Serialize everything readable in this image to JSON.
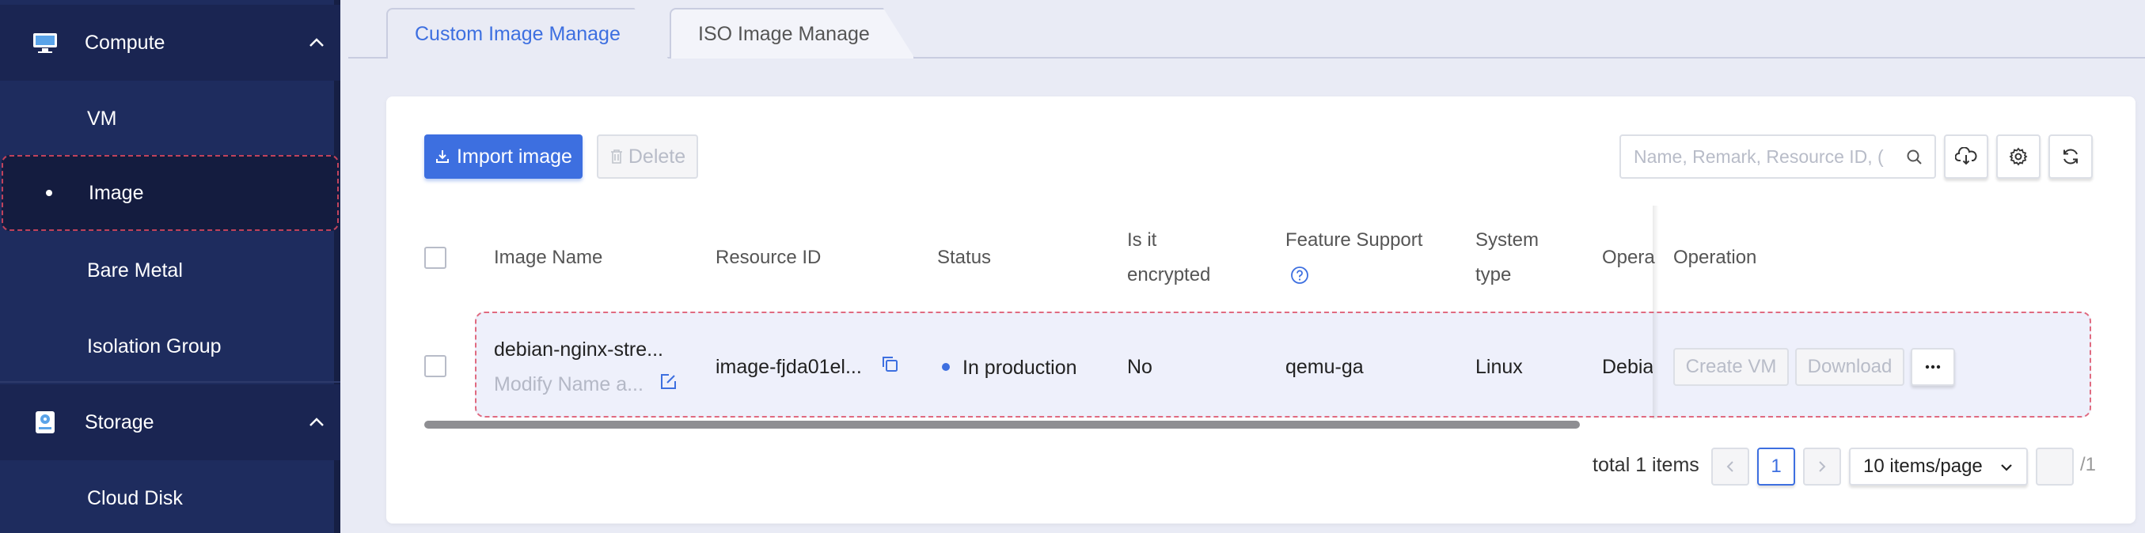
{
  "sidebar": {
    "groups": [
      {
        "label": "Compute",
        "icon": "monitor-icon"
      },
      {
        "label": "Storage",
        "icon": "storage-icon"
      }
    ],
    "items": [
      {
        "label": "VM"
      },
      {
        "label": "Image"
      },
      {
        "label": "Bare Metal"
      },
      {
        "label": "Isolation Group"
      },
      {
        "label": "Cloud Disk"
      }
    ]
  },
  "tabs": [
    {
      "label": "Custom Image Manage",
      "active": true
    },
    {
      "label": "ISO Image Manage",
      "active": false
    }
  ],
  "toolbar": {
    "import_label": "Import image",
    "delete_label": "Delete",
    "search_placeholder": "Name, Remark, Resource ID, (",
    "icons": [
      "cloud-download-icon",
      "gear-icon",
      "refresh-icon"
    ]
  },
  "table": {
    "headers": {
      "image_name": "Image Name",
      "resource_id": "Resource ID",
      "status": "Status",
      "encrypted_1": "Is it",
      "encrypted_2": "encrypted",
      "feature": "Feature Support",
      "system_1": "System",
      "system_2": "type",
      "os": "Opera",
      "operation": "Operation"
    },
    "rows": [
      {
        "name": "debian-nginx-stre...",
        "remark": "Modify Name a...",
        "resource_id": "image-fjda01el...",
        "status": "In production",
        "encrypted": "No",
        "feature": "qemu-ga",
        "system": "Linux",
        "os": "Debia",
        "ops": {
          "create": "Create VM",
          "download": "Download",
          "more": "···"
        }
      }
    ]
  },
  "pagination": {
    "total": "total 1 items",
    "prev": "<",
    "page": "1",
    "next": ">",
    "size": "10 items/page",
    "of": "/1"
  },
  "colors": {
    "accent": "#3d6fe0",
    "sidebar": "#1e2c5e"
  }
}
